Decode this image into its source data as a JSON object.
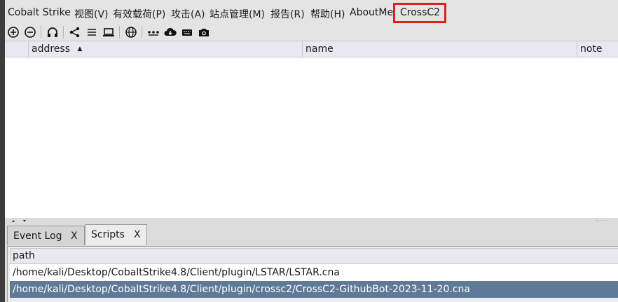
{
  "menubar": {
    "items": [
      {
        "label": "Cobalt Strike"
      },
      {
        "label": "视图(V)"
      },
      {
        "label": "有效载荷(P)"
      },
      {
        "label": "攻击(A)"
      },
      {
        "label": "站点管理(M)"
      },
      {
        "label": "报告(R)"
      },
      {
        "label": "帮助(H)"
      },
      {
        "label": "AboutMe"
      },
      {
        "label": "CrossC2"
      }
    ],
    "highlight_color": "#e0201c"
  },
  "toolbar": {
    "icons": [
      "plus-circle-icon",
      "minus-circle-icon",
      "headphones-icon",
      "share-icon",
      "list-icon",
      "laptop-icon",
      "globe-icon",
      "dots-icon",
      "cloud-download-icon",
      "keyboard-icon",
      "camera-icon"
    ]
  },
  "targets_table": {
    "columns": [
      {
        "label": "address"
      },
      {
        "label": "name"
      },
      {
        "label": "note"
      }
    ],
    "sort_indicator": "▲"
  },
  "bottom_tabs": {
    "tabs": [
      {
        "label": "Event Log",
        "close": "X",
        "active": false
      },
      {
        "label": "Scripts",
        "close": "X",
        "active": true
      }
    ]
  },
  "scripts_table": {
    "header": "path",
    "rows": [
      {
        "path": "/home/kali/Desktop/CobaltStrike4.8/Client/plugin/LSTAR/LSTAR.cna",
        "selected": false
      },
      {
        "path": "/home/kali/Desktop/CobaltStrike4.8/Client/plugin/crossc2/CrossC2-GithubBot-2023-11-20.cna",
        "selected": true
      }
    ],
    "selected_color": "#5e7a96"
  }
}
